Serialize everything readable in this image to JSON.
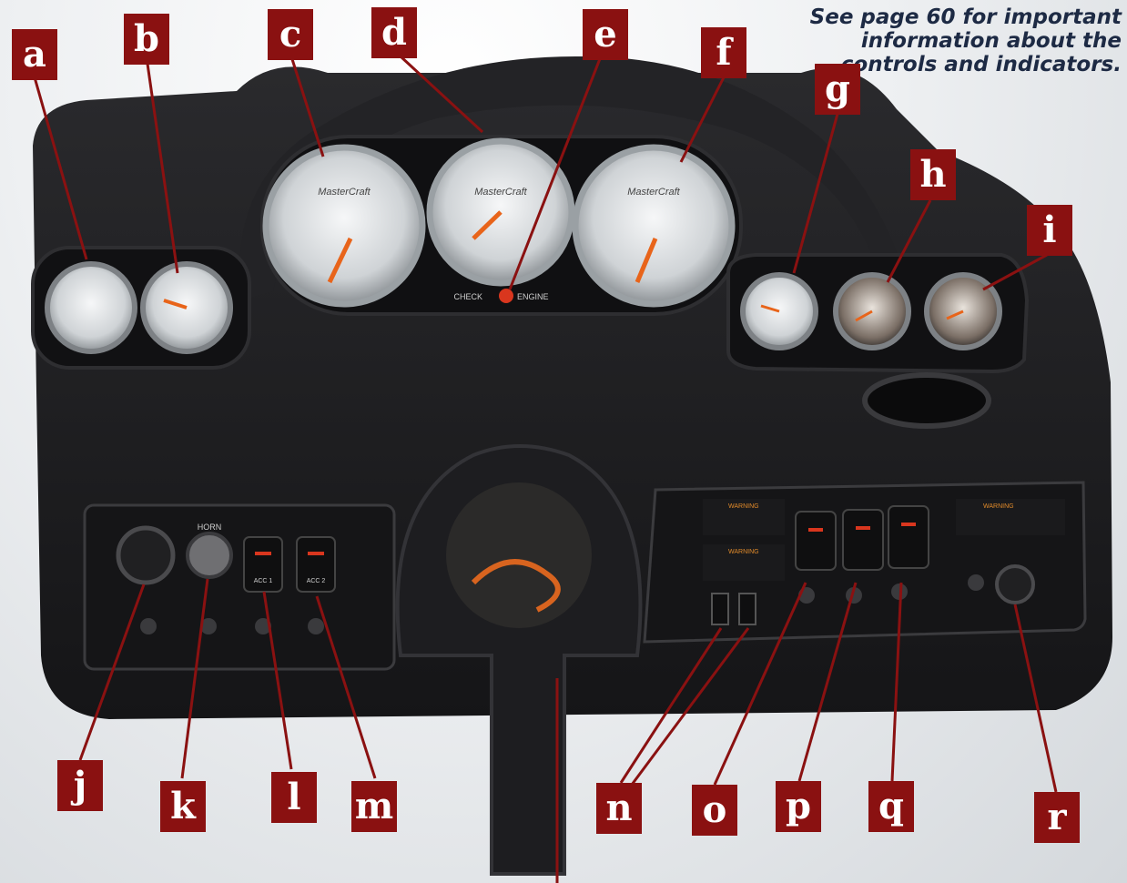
{
  "note": "See page 60 for important information about the controls and indicators.",
  "callouts": {
    "a": "a",
    "b": "b",
    "c": "c",
    "d": "d",
    "e": "e",
    "f": "f",
    "g": "g",
    "h": "h",
    "i": "i",
    "j": "j",
    "k": "k",
    "l": "l",
    "m": "m",
    "n": "n",
    "o": "o",
    "p": "p",
    "q": "q",
    "r": "r"
  },
  "panel_labels": {
    "brand": "MasterCraft",
    "check": "CHECK",
    "engine": "ENGINE",
    "horn": "HORN",
    "acc1": "ACC 1",
    "acc2": "ACC 2",
    "warning": "WARNING"
  },
  "colors": {
    "callout_bg": "#8a1111",
    "callout_text": "#ffffff",
    "note_text": "#1d2a44",
    "dash": "#1c1c1e",
    "needle": "#e8641a",
    "check_engine_lamp": "#d9361e"
  }
}
